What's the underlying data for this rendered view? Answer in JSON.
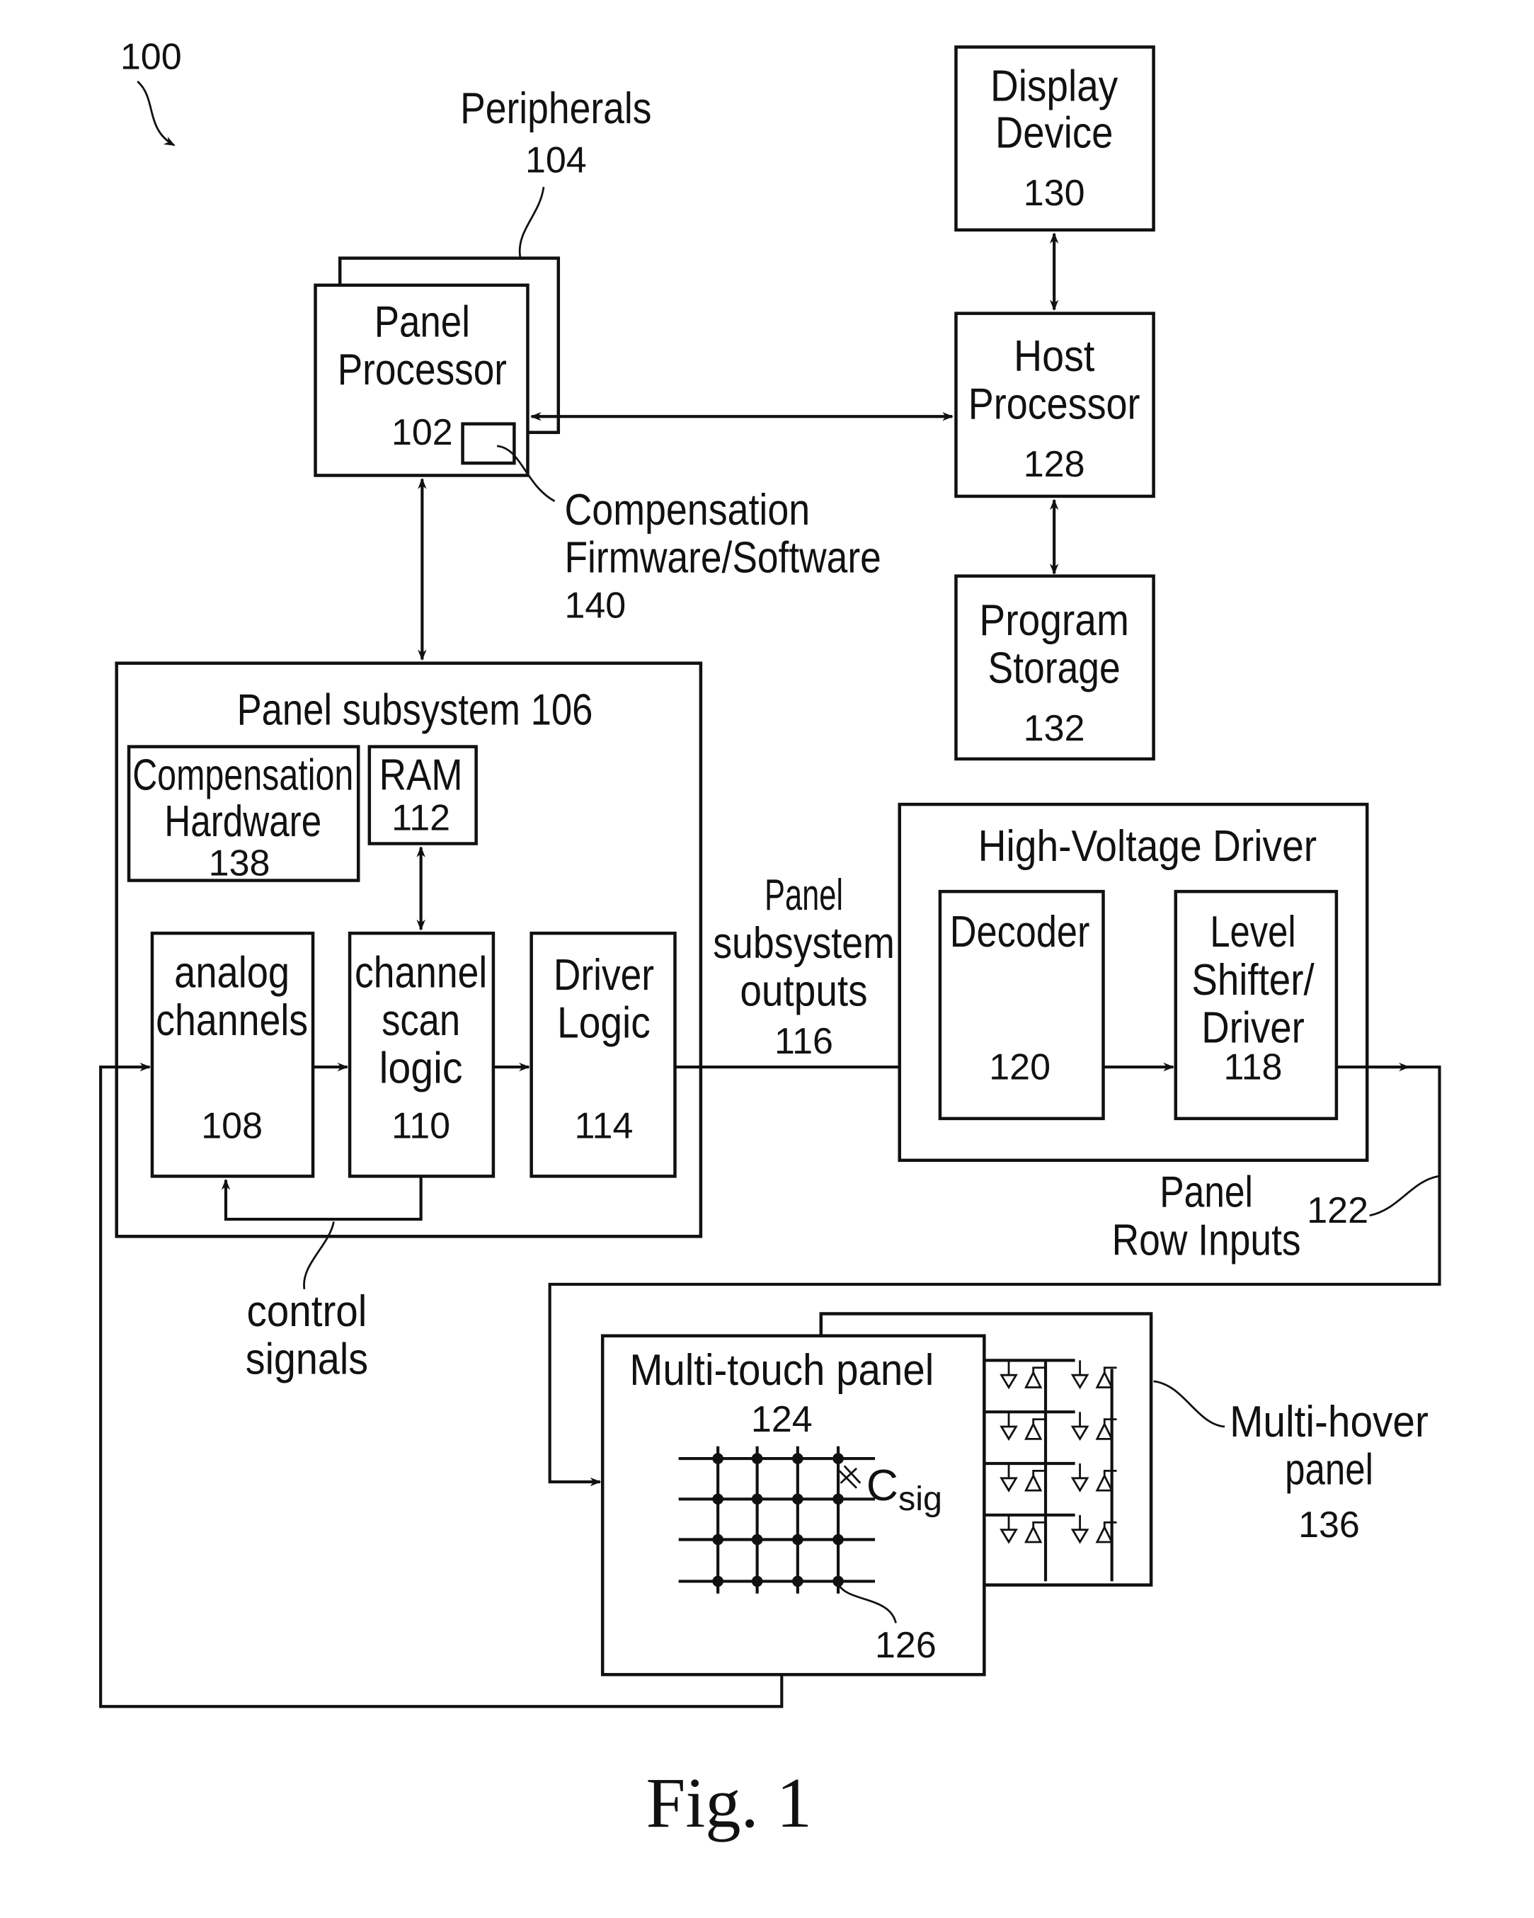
{
  "figure": {
    "ref": "100",
    "caption": "Fig. 1"
  },
  "peripherals": {
    "label": "Peripherals",
    "ref": "104"
  },
  "panel_processor": {
    "line1": "Panel",
    "line2": "Processor",
    "ref": "102"
  },
  "compensation_fw": {
    "line1": "Compensation",
    "line2": "Firmware/Software",
    "ref": "140"
  },
  "display_device": {
    "line1": "Display",
    "line2": "Device",
    "ref": "130"
  },
  "host_processor": {
    "line1": "Host",
    "line2": "Processor",
    "ref": "128"
  },
  "program_storage": {
    "line1": "Program",
    "line2": "Storage",
    "ref": "132"
  },
  "panel_subsystem": {
    "title": "Panel subsystem 106",
    "compensation_hw": {
      "line1": "Compensation",
      "line2": "Hardware",
      "ref": "138"
    },
    "ram": {
      "label": "RAM",
      "ref": "112"
    },
    "analog_channels": {
      "line1": "analog",
      "line2": "channels",
      "ref": "108"
    },
    "channel_scan_logic": {
      "line1": "channel",
      "line2": "scan",
      "line3": "logic",
      "ref": "110"
    },
    "driver_logic": {
      "line1": "Driver",
      "line2": "Logic",
      "ref": "114"
    }
  },
  "control_signals": {
    "line1": "control",
    "line2": "signals"
  },
  "subsystem_outputs": {
    "line1": "Panel",
    "line2": "subsystem",
    "line3": "outputs",
    "ref": "116"
  },
  "hv_driver": {
    "title": "High-Voltage Driver",
    "decoder": {
      "label": "Decoder",
      "ref": "120"
    },
    "level_shifter": {
      "line1": "Level",
      "line2": "Shifter/",
      "line3": "Driver",
      "ref": "118"
    }
  },
  "row_inputs": {
    "line1": "Panel",
    "line2": "Row Inputs",
    "ref": "122"
  },
  "multi_touch": {
    "label": "Multi-touch panel",
    "ref": "124",
    "csig_main": "C",
    "csig_sub": "sig",
    "node_ref": "126"
  },
  "multi_hover": {
    "line1": "Multi-hover",
    "line2": "panel",
    "ref": "136"
  }
}
